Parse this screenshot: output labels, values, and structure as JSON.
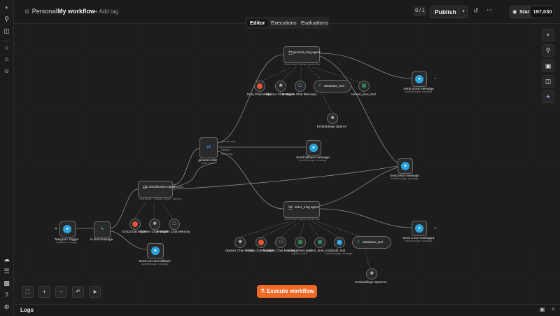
{
  "header": {
    "project": "Personal",
    "workflow_name": "My workflow",
    "add_tag": "+ Add tag",
    "version_counter": "0 / 1",
    "publish_label": "Publish",
    "star_label": "Star",
    "star_count": "197,030"
  },
  "tabs": [
    "Editor",
    "Executions",
    "Evaluations"
  ],
  "canvas": {
    "execute_label": "Execute workflow",
    "logs_label": "Logs"
  },
  "nodes": {
    "telegram_trigger": {
      "label": "Telegram Trigger",
      "sub": "Updates: message"
    },
    "is_text": {
      "label": "Is text message"
    },
    "classification": {
      "label": "AI classification Agent"
    },
    "send_non_text": {
      "label": "Send non-text fallback",
      "sub": "sendMessage: message"
    },
    "groq1": {
      "label": "Groq Chat Model"
    },
    "openai1": {
      "label": "OpenAI Chat Model"
    },
    "postgres1": {
      "label": "Postgres Chat Memory"
    },
    "general_order": {
      "label": "general-order",
      "sub": "mode: Rules"
    },
    "general_msg": {
      "label": "general_msg agent"
    },
    "groq2": {
      "label": "Groq Chat Model"
    },
    "openai2": {
      "label": "OpenAI Chat Model"
    },
    "postgres2": {
      "label": "Postgres Chat Memory1"
    },
    "database_tool1": {
      "label": "database_tool"
    },
    "current_time1": {
      "label": "current_time_tool"
    },
    "embeddings1": {
      "label": "Embeddings OpenAI"
    },
    "send_text1": {
      "label": "Send a text message",
      "sub": "sendMessage: message"
    },
    "send_fallback": {
      "label": "Send fallback message",
      "sub": "sendMessage: message"
    },
    "send_error": {
      "label": "Send error message",
      "sub": "sendMessage: message"
    },
    "order_msg": {
      "label": "order_msg agent"
    },
    "openai3": {
      "label": "OpenAI Chat Model"
    },
    "groq3": {
      "label": "Groq Chat Model1"
    },
    "postgres3": {
      "label": "Postgres Chat Memory2"
    },
    "order_sheet": {
      "label": "order_sheet_tool",
      "sub": "append: sheet"
    },
    "current_time2": {
      "label": "current_time_tool1"
    },
    "notif_tool": {
      "label": "notif_tool",
      "sub": "sendMessage: message"
    },
    "database_tool2": {
      "label": "database_tool"
    },
    "embeddings2": {
      "label": "Embeddings OpenAI1"
    },
    "send_text2": {
      "label": "Send a text message1",
      "sub": "sendMessage: message"
    }
  },
  "edge_labels": {
    "general_msg": "general_msg",
    "order_msg": "order_msg",
    "fallback": "Fallback",
    "model": "Model",
    "memory": "Memory",
    "tool": "Tool",
    "embedding": "Embedding",
    "chat_model": "Chat Model",
    "fallback_model": "Fallback Model"
  },
  "colors": {
    "accent": "#f06a25",
    "telegram": "#2aa3dc",
    "groq": "#e25534",
    "postgres": "#5b7fc7",
    "tool_green": "#3cb77a",
    "route_blue": "#3a7bd5"
  }
}
